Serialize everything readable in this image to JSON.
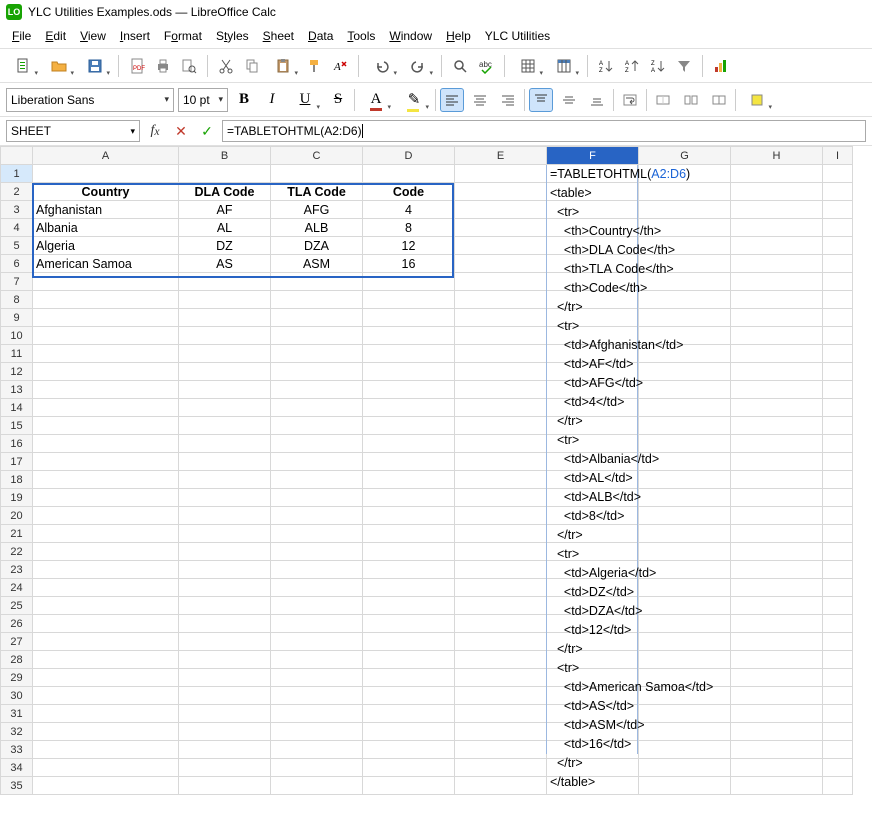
{
  "title": "YLC Utilities Examples.ods — LibreOffice Calc",
  "logo_text": "LO",
  "menus": [
    "File",
    "Edit",
    "View",
    "Insert",
    "Format",
    "Styles",
    "Sheet",
    "Data",
    "Tools",
    "Window",
    "Help",
    "YLC Utilities"
  ],
  "font_name": "Liberation Sans",
  "font_size": "10 pt",
  "name_box": "SHEET",
  "formula_bar": "=TABLETOHTML(A2:D6)",
  "col_headers": [
    "A",
    "B",
    "C",
    "D",
    "E",
    "F",
    "G",
    "H",
    "I"
  ],
  "row_count": 35,
  "active_col": "F",
  "sel_row_label": "1",
  "data_table": {
    "headers": [
      "Country",
      "DLA Code",
      "TLA Code",
      "Code"
    ],
    "rows": [
      [
        "Afghanistan",
        "AF",
        "AFG",
        "4"
      ],
      [
        "Albania",
        "AL",
        "ALB",
        "8"
      ],
      [
        "Algeria",
        "DZ",
        "DZA",
        "12"
      ],
      [
        "American Samoa",
        "AS",
        "ASM",
        "16"
      ]
    ]
  },
  "f1_formula_pre": "=TABLETOHTML(",
  "f1_formula_ref": "A2:D6",
  "f1_formula_post": ")",
  "html_output": [
    "<table>",
    "  <tr>",
    "    <th>Country</th>",
    "    <th>DLA Code</th>",
    "    <th>TLA Code</th>",
    "    <th>Code</th>",
    "  </tr>",
    "  <tr>",
    "    <td>Afghanistan</td>",
    "    <td>AF</td>",
    "    <td>AFG</td>",
    "    <td>4</td>",
    "  </tr>",
    "  <tr>",
    "    <td>Albania</td>",
    "    <td>AL</td>",
    "    <td>ALB</td>",
    "    <td>8</td>",
    "  </tr>",
    "  <tr>",
    "    <td>Algeria</td>",
    "    <td>DZ</td>",
    "    <td>DZA</td>",
    "    <td>12</td>",
    "  </tr>",
    "  <tr>",
    "    <td>American Samoa</td>",
    "    <td>AS</td>",
    "    <td>ASM</td>",
    "    <td>16</td>",
    "  </tr>",
    "</table>"
  ]
}
